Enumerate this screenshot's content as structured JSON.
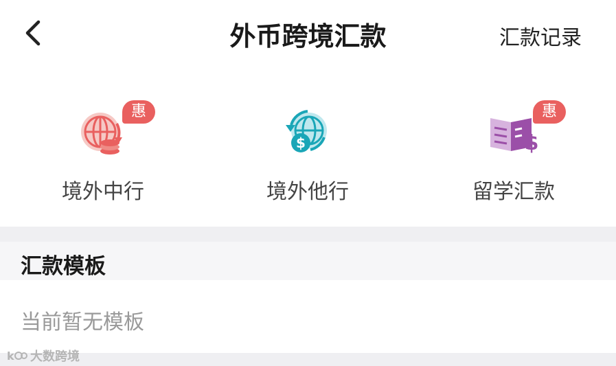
{
  "header": {
    "title": "外币跨境汇款",
    "records_label": "汇款记录",
    "back_icon": "chevron-left-icon"
  },
  "services": [
    {
      "label": "境外中行",
      "icon": "globe-coins-icon",
      "badge": "惠",
      "color": "#e9605f"
    },
    {
      "label": "境外他行",
      "icon": "globe-dollar-icon",
      "badge": "",
      "color": "#1aa6b7"
    },
    {
      "label": "留学汇款",
      "icon": "book-dollar-icon",
      "badge": "惠",
      "color": "#9b4fa8"
    }
  ],
  "templates": {
    "title": "汇款模板",
    "empty_text": "当前暂无模板"
  },
  "watermark": {
    "text": "大数跨境"
  }
}
